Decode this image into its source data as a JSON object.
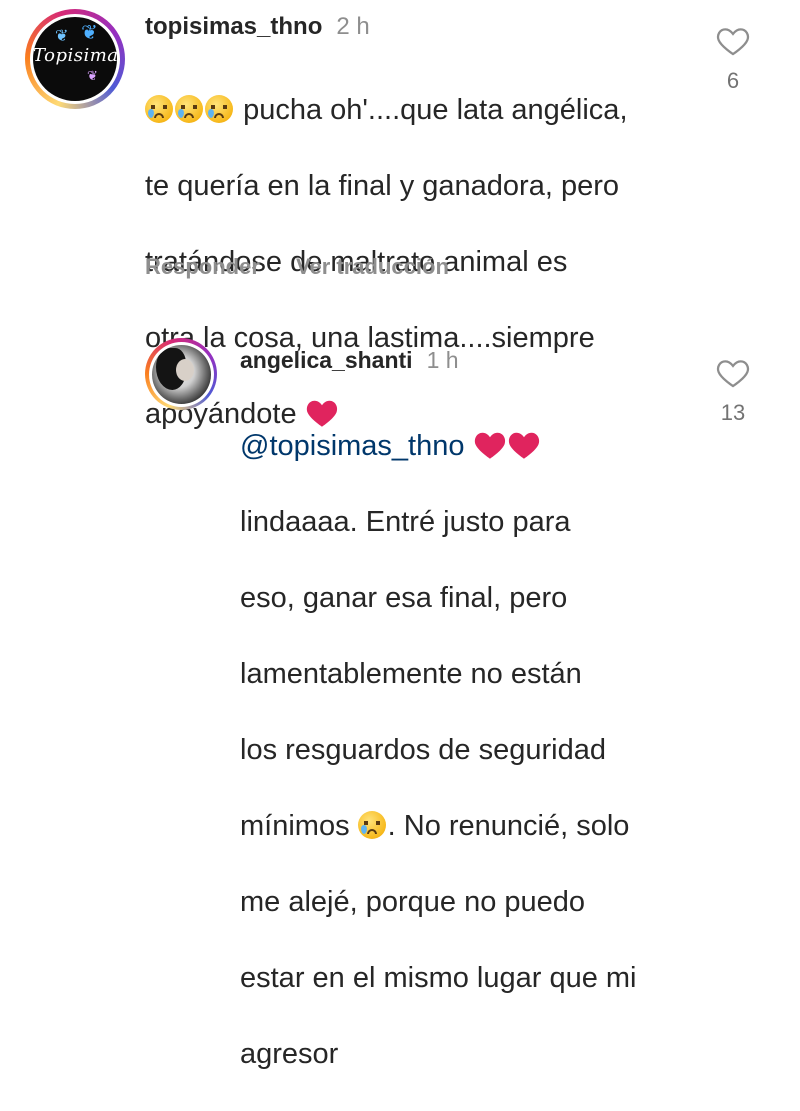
{
  "comments": [
    {
      "username": "topisimas_thno",
      "time": "2 h",
      "avatar": {
        "logo_text": "Topisimas",
        "style": "black circle logo with butterflies"
      },
      "text_lines": [
        "pucha oh'....que lata angélica,",
        "te quería en la final y ganadora, pero",
        "tratándose de maltrato animal es",
        "otra la cosa, una lastima....siempre",
        "apoyándote"
      ],
      "emojis": [
        "crying-face-emoji",
        "crying-face-emoji",
        "crying-face-emoji",
        "red-heart-emoji"
      ],
      "likes": "6",
      "actions": {
        "reply": "Responder",
        "translate": "Ver traducción"
      }
    },
    {
      "username": "angelica_shanti",
      "time": "1 h",
      "mention": "@topisimas_thno",
      "text_lines": [
        "lindaaaa. Entré justo para",
        "eso, ganar esa final, pero",
        "lamentablemente no están",
        "los resguardos de seguridad",
        "mínimos",
        ". No renuncié, solo",
        "me alejé, porque no puedo",
        "estar en el mismo lugar que mi",
        "agresor"
      ],
      "emojis": [
        "red-heart-emoji",
        "red-heart-emoji",
        "crying-face-emoji"
      ],
      "likes": "13"
    }
  ],
  "colors": {
    "text": "#262626",
    "secondary": "#8e8e8e",
    "mention": "#00376b",
    "heart": "#e0245e"
  },
  "icons": {
    "like": "heart-outline-icon"
  }
}
